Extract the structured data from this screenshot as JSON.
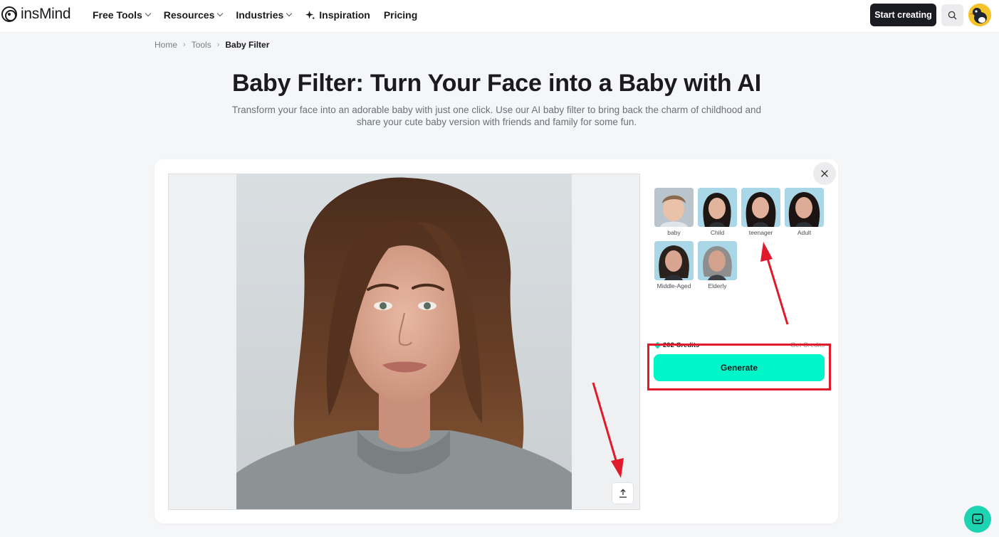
{
  "brand": {
    "name": "insMind"
  },
  "nav": {
    "items": [
      {
        "label": "Free Tools",
        "dropdown": true
      },
      {
        "label": "Resources",
        "dropdown": true
      },
      {
        "label": "Industries",
        "dropdown": true
      },
      {
        "label": "Inspiration",
        "icon": "sparkle-icon"
      },
      {
        "label": "Pricing"
      }
    ],
    "start_label": "Start creating"
  },
  "breadcrumb": {
    "items": [
      "Home",
      "Tools"
    ],
    "current": "Baby Filter"
  },
  "hero": {
    "title": "Baby Filter: Turn Your Face into a Baby with AI",
    "subtitle": "Transform your face into an adorable baby with just one click. Use our AI baby filter to bring back the charm of childhood and share your cute baby version with friends and family for some fun."
  },
  "styles": [
    {
      "label": "baby"
    },
    {
      "label": "Child"
    },
    {
      "label": "teenager"
    },
    {
      "label": "Adult"
    },
    {
      "label": "Middle-Aged"
    },
    {
      "label": "Elderly"
    }
  ],
  "credits": {
    "amount": "202 Credits",
    "get_label": "Get Credits"
  },
  "generate_label": "Generate",
  "colors": {
    "accent": "#00f5c8",
    "annotation": "#e01a2b",
    "dark_button": "#1b1c22",
    "chat": "#1dd4b2"
  }
}
